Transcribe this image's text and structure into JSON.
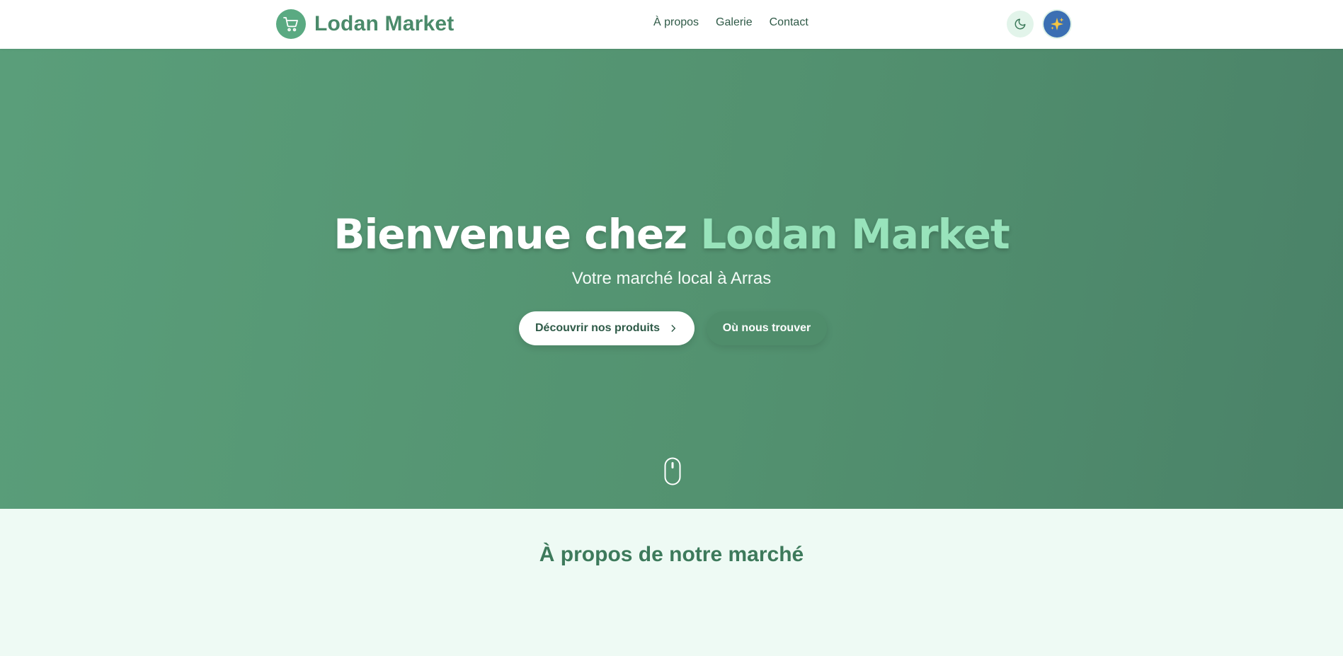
{
  "header": {
    "brand_name": "Lodan Market",
    "nav": [
      "À propos",
      "Galerie",
      "Contact"
    ]
  },
  "hero": {
    "title_prefix": "Bienvenue chez ",
    "title_accent": "Lodan Market",
    "subtitle": "Votre marché local à Arras",
    "primary_button": "Découvrir nos produits",
    "secondary_button": "Où nous trouver"
  },
  "about": {
    "title": "À propos de notre marché"
  },
  "colors": {
    "brand": "#5aaa82",
    "hero_start": "#5a9e7a",
    "hero_end": "#4a8268",
    "accent_text": "#98e3bb",
    "about_bg": "#eefaf4",
    "heading": "#3d7a5b"
  },
  "icons": {
    "brand": "shopping-cart-icon",
    "theme": "moon-icon",
    "ai": "sparkles-icon",
    "button": "chevron-right-icon",
    "scroll": "mouse-scroll-icon"
  }
}
